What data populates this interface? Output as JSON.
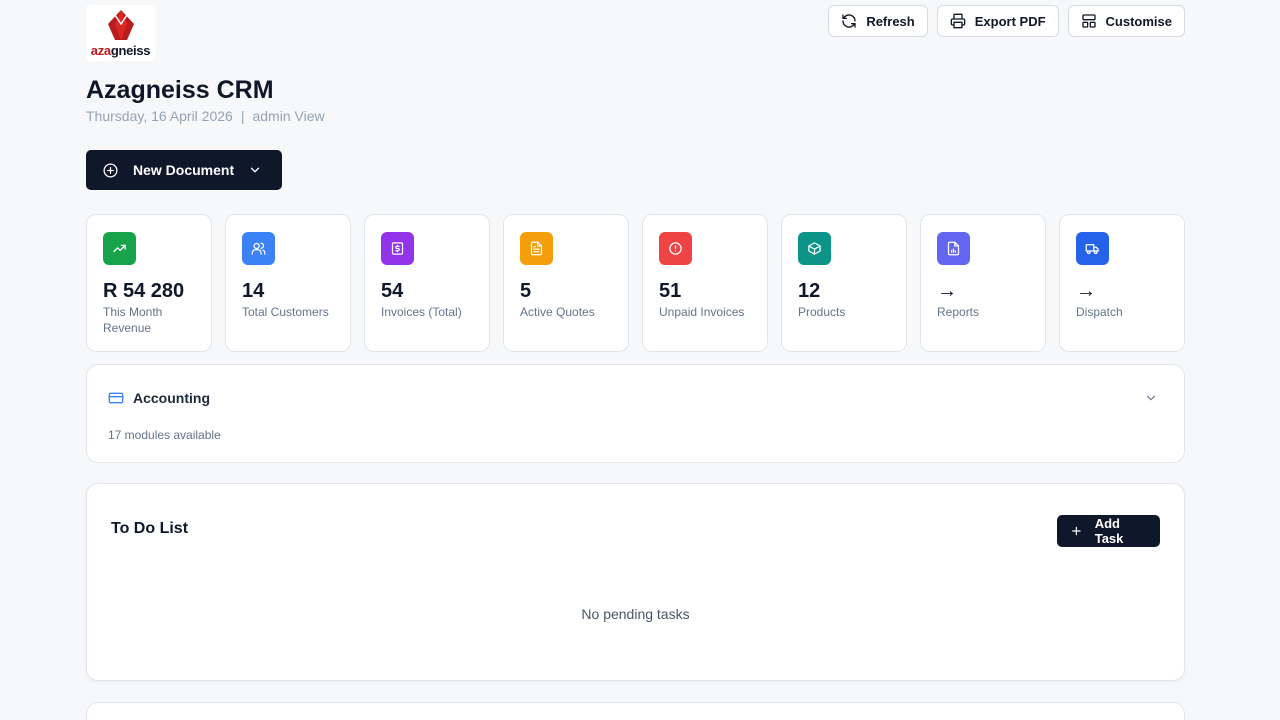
{
  "brand": {
    "logo_text_a": "aza",
    "logo_text_b": "gneiss",
    "colors": {
      "mark": "#b91c1c",
      "primary": "#0f172a"
    }
  },
  "toolbar": {
    "refresh_label": "Refresh",
    "export_label": "Export PDF",
    "customise_label": "Customise"
  },
  "header": {
    "title": "Azagneiss CRM",
    "date": "Thursday, 16 April 2026",
    "separator": "|",
    "view": "admin View"
  },
  "new_document": {
    "label": "New Document"
  },
  "stats": [
    {
      "value": "R 54 280",
      "label": "This Month Revenue",
      "icon": "trending-up-icon",
      "color": "#16a34a"
    },
    {
      "value": "14",
      "label": "Total Customers",
      "icon": "users-icon",
      "color": "#3b82f6"
    },
    {
      "value": "54",
      "label": "Invoices (Total)",
      "icon": "invoice-icon",
      "color": "#9333ea"
    },
    {
      "value": "5",
      "label": "Active Quotes",
      "icon": "document-icon",
      "color": "#f59e0b"
    },
    {
      "value": "51",
      "label": "Unpaid Invoices",
      "icon": "alert-icon",
      "color": "#ef4444"
    },
    {
      "value": "12",
      "label": "Products",
      "icon": "box-icon",
      "color": "#0d9488"
    },
    {
      "value": "→",
      "label": "Reports",
      "icon": "report-icon",
      "color": "#6366f1"
    },
    {
      "value": "→",
      "label": "Dispatch",
      "icon": "truck-icon",
      "color": "#2563eb"
    }
  ],
  "accounting": {
    "title": "Accounting",
    "subtitle": "17 modules available"
  },
  "todo": {
    "title": "To Do List",
    "add_label": "Add Task",
    "empty_text": "No pending tasks"
  }
}
